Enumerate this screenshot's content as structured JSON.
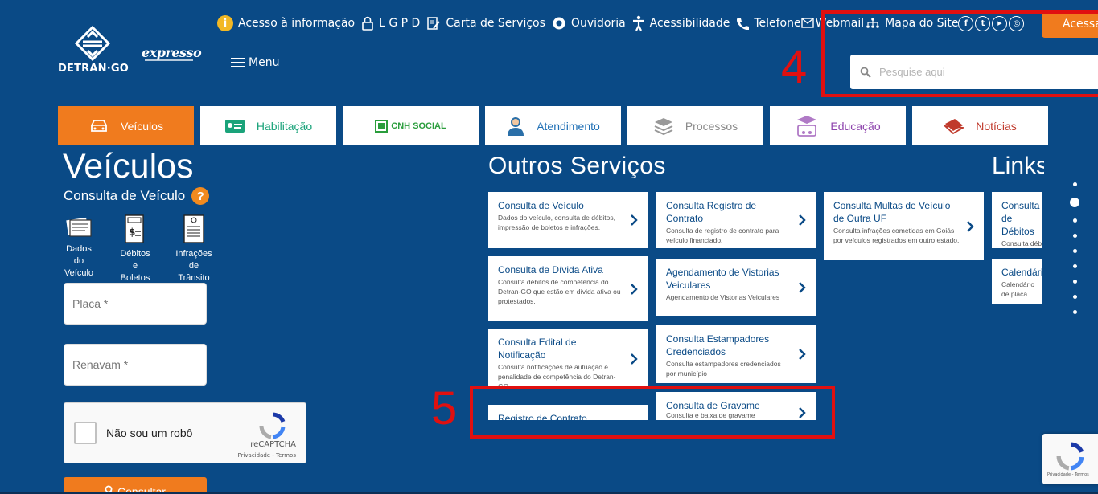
{
  "header": {
    "logo_text": "DETRAN·GO",
    "expresso": "expresso",
    "menu_label": "Menu",
    "topnav": [
      {
        "label": "Acesso à informação",
        "icon": "info-icon"
      },
      {
        "label": "L G P D",
        "icon": "lock-icon"
      },
      {
        "label": "Carta de Serviços",
        "icon": "document-edit-icon"
      },
      {
        "label": "Ouvidoria",
        "icon": "chat-bubble-icon"
      },
      {
        "label": "Acessibilidade",
        "icon": "accessibility-icon"
      },
      {
        "label": "Telefone",
        "icon": "phone-icon"
      },
      {
        "label": "Webmail",
        "icon": "envelope-icon"
      },
      {
        "label": "Mapa do Site",
        "icon": "sitemap-icon"
      }
    ],
    "social": [
      {
        "name": "facebook-icon",
        "glyph": "f"
      },
      {
        "name": "twitter-icon",
        "glyph": "t"
      },
      {
        "name": "youtube-icon",
        "glyph": "▶"
      },
      {
        "name": "instagram-icon",
        "glyph": "◎"
      }
    ],
    "acessar_label": "Acessar",
    "search_placeholder": "Pesquise aqui"
  },
  "annotations": {
    "box4_number": "4",
    "box5_number": "5"
  },
  "tabs": [
    {
      "label": "Veículos",
      "color": "#ffffff",
      "active": true
    },
    {
      "label": "Habilitação",
      "color": "#1aa37a"
    },
    {
      "label": "CNH SOCIAL",
      "color": "#2a9d3c"
    },
    {
      "label": "Atendimento",
      "color": "#1f6fb5"
    },
    {
      "label": "Processos",
      "color": "#8a8a8a"
    },
    {
      "label": "Educação",
      "color": "#8e44ad"
    },
    {
      "label": "Notícias",
      "color": "#c0392b"
    }
  ],
  "veiculos": {
    "title": "Veículos",
    "subtitle": "Consulta de Veículo",
    "help": "?",
    "options": [
      {
        "line1": "Dados",
        "line2": "do",
        "line3": "Veículo"
      },
      {
        "line1": "Débitos",
        "line2": "e",
        "line3": "Boletos"
      },
      {
        "line1": "Infrações",
        "line2": "de",
        "line3": "Trânsito"
      }
    ],
    "placa_placeholder": "Placa *",
    "renavam_placeholder": "Renavam *",
    "captcha_label": "Não sou um robô",
    "captcha_brand": "reCAPTCHA",
    "captcha_links": "Privacidade - Termos",
    "consultar_label": "Consultar"
  },
  "outros": {
    "title": "Outros Serviços",
    "cards": [
      {
        "title": "Consulta de Veículo",
        "desc": "Dados do veículo, consulta de débitos, impressão de boletos e infrações."
      },
      {
        "title": "Consulta de Dívida Ativa",
        "desc": "Consulta débitos de competência do Detran-GO que estão em dívida ativa ou protestados."
      },
      {
        "title": "Consulta Edital de Notificação",
        "desc": "Consulta notificações de autuação e penalidade de competência do Detran-GO"
      },
      {
        "title": "Registro de Contrato",
        "desc": ""
      },
      {
        "title": "Consulta Registro de Contrato",
        "desc": "Consulta de registro de contrato para veículo financiado."
      },
      {
        "title": "Agendamento de Vistorias Veiculares",
        "desc": "Agendamento de Vistorias Veiculares"
      },
      {
        "title": "Consulta Estampadores Credenciados",
        "desc": "Consulta estampadores credenciados por município"
      },
      {
        "title": "Consulta de Gravame",
        "desc": "Consulta e baixa de gravame"
      },
      {
        "title": "Consulta Multas de Veículo de Outra UF",
        "desc": "Consulta infrações cometidas em Goiás por veículos registrados em outro estado."
      }
    ]
  },
  "links": {
    "title": "Links",
    "cards": [
      {
        "title": "Consulta de Débitos",
        "desc": "Consulta débitos veículo"
      },
      {
        "title": "Calendário",
        "desc": "Calendário de placa."
      }
    ]
  },
  "recaptcha_badge": {
    "links": "Privacidade - Termos"
  }
}
